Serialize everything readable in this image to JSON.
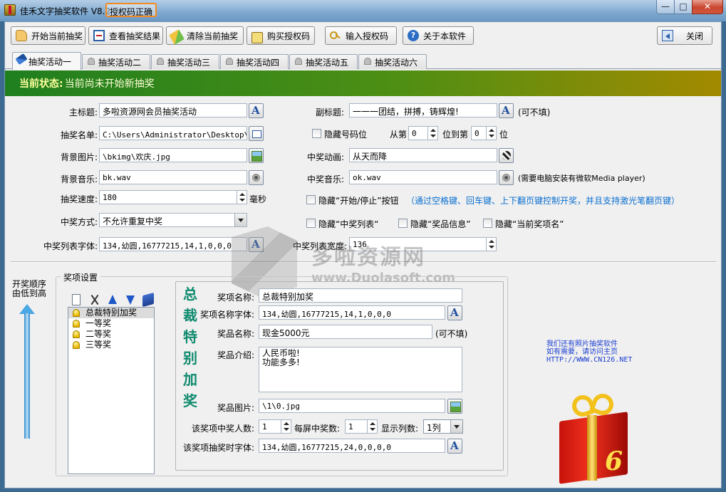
{
  "window": {
    "title": "佳禾文字抽奖软件 V8.2",
    "auth_status": "授权码正确",
    "min_glyph": "—",
    "max_glyph": "□",
    "close_glyph": "✕"
  },
  "toolbar": {
    "start": "开始当前抽奖",
    "view": "查看抽奖结果",
    "clear": "清除当前抽奖",
    "buy": "购买授权码",
    "enter": "输入授权码",
    "about": "关于本软件",
    "close": "关闭"
  },
  "tabs": [
    "抽奖活动一",
    "抽奖活动二",
    "抽奖活动三",
    "抽奖活动四",
    "抽奖活动五",
    "抽奖活动六"
  ],
  "status": {
    "label": "当前状态:",
    "text": "当前尚未开始新抽奖"
  },
  "form": {
    "main_title_label": "主标题:",
    "main_title_value": "多啦资源网会员抽奖活动",
    "subtitle_label": "副标题:",
    "subtitle_value": "一一一团结，拼搏，铸辉煌!",
    "subtitle_note": "(可不填)",
    "list_label": "抽奖名单:",
    "list_value": "C:\\Users\\Administrator\\Desktop\\文字",
    "hide_digits_label": "隐藏号码位",
    "from_label": "从第",
    "from_value": "0",
    "to_label": "位到第",
    "to_value": "0",
    "pos_label": "位",
    "bg_image_label": "背景图片:",
    "bg_image_value": "\\bkimg\\欢庆.jpg",
    "anim_label": "中奖动画:",
    "anim_value": "从天而降",
    "bg_music_label": "背景音乐:",
    "bg_music_value": "bk.wav",
    "win_music_label": "中奖音乐:",
    "win_music_value": "ok.wav",
    "win_music_note": "(需要电脑安装有微软Media player)",
    "speed_label": "抽奖速度:",
    "speed_value": "180",
    "speed_unit": "毫秒",
    "hide_button_label": "隐藏“开始/停止”按钮",
    "hide_button_note": "（通过空格键、回车键、上下翻页键控制开奖，并且支持激光笔翻页键）",
    "mode_label": "中奖方式:",
    "mode_value": "不允许重复中奖",
    "hide_list_label": "隐藏“中奖列表“",
    "hide_prize_label": "隐藏“奖品信息”",
    "hide_current_label": "隐藏“当前奖项名”",
    "list_font_label": "中奖列表字体:",
    "list_font_value": "134,幼圆,16777215,14,1,0,0,0",
    "list_width_label": "中奖列表宽度:",
    "list_width_value": "136"
  },
  "watermark": {
    "cn": "多啦资源网",
    "en": "www.Duolasoft.com"
  },
  "lower": {
    "order_label": "开奖顺序由低到高",
    "group_title": "奖项设置",
    "prizes": [
      "总裁特别加奖",
      "一等奖",
      "二等奖",
      "三等奖"
    ],
    "vertical_title": "总裁特别加奖",
    "prize_name_label": "奖项名称:",
    "prize_name_value": "总裁特别加奖",
    "prize_font_label": "奖项名称字体:",
    "prize_font_value": "134,幼圆,16777215,14,1,0,0,0",
    "goods_name_label": "奖品名称:",
    "goods_name_value": "现金5000元",
    "goods_name_note": "(可不填)",
    "goods_desc_label": "奖品介绍:",
    "goods_desc_line1": "人民币啦!",
    "goods_desc_line2": "功能多多!",
    "goods_image_label": "奖品图片:",
    "goods_image_value": "\\1\\0.jpg",
    "winners_label": "该奖项中奖人数:",
    "winners_value": "1",
    "per_screen_label": "每屏中奖数:",
    "per_screen_value": "1",
    "columns_label": "显示列数:",
    "columns_value": "1列",
    "draw_font_label": "该奖项抽奖时字体:",
    "draw_font_value": "134,幼圆,16777215,24,0,0,0,0"
  },
  "promo": {
    "line1": "我们还有照片抽奖软件",
    "line2": "如有需要，请访问主页",
    "line3": "HTTP://WWW.CN126.NET"
  }
}
